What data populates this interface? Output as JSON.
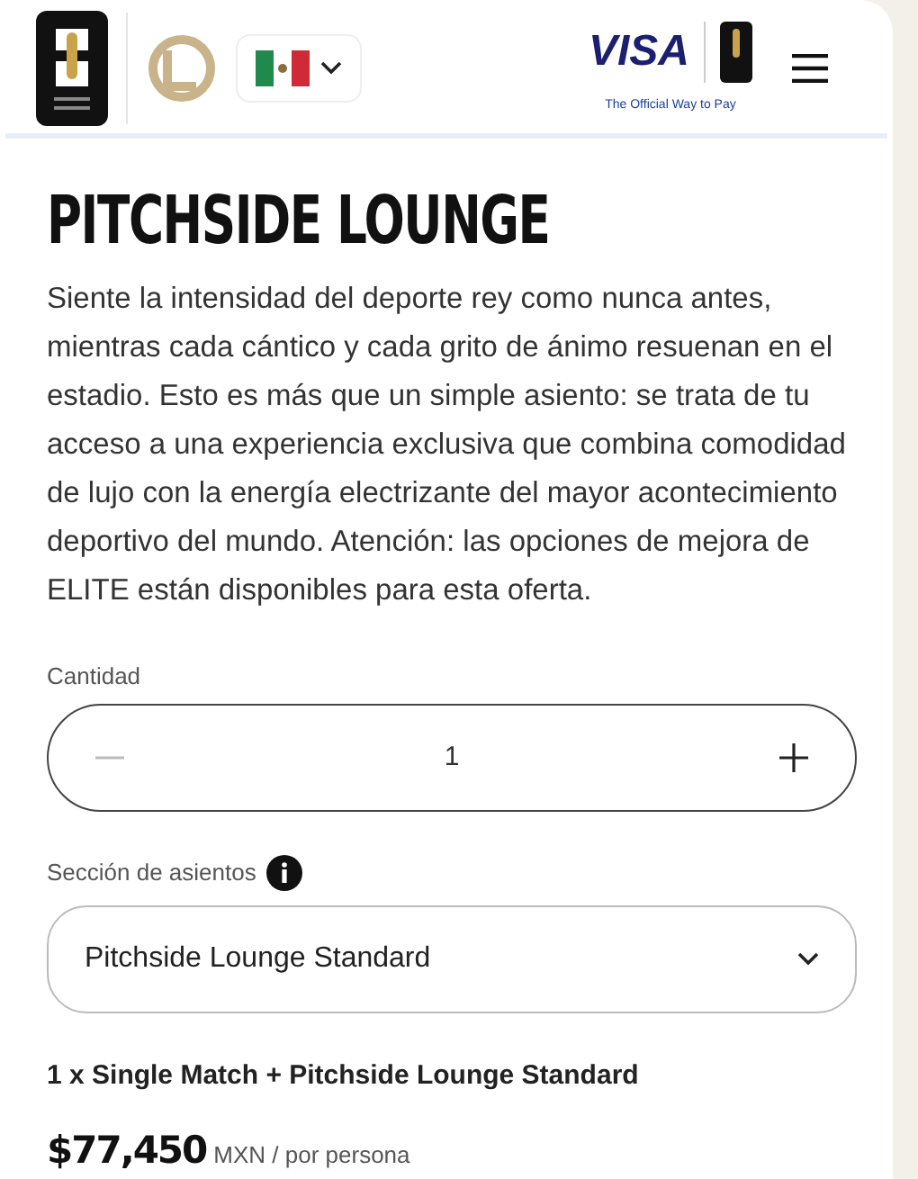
{
  "header": {
    "sponsor": {
      "name": "VISA",
      "tagline": "The Official Way to Pay"
    }
  },
  "product": {
    "title": "PITCHSIDE LOUNGE",
    "description": "Siente la intensidad del deporte rey como nunca antes, mientras cada cántico y cada grito de ánimo resuenan en el estadio. Esto es más que un simple asiento: se trata de tu acceso a una experiencia exclusiva que combina comodidad de lujo con la energía electrizante del mayor acontecimiento deportivo del mundo. Atención: las opciones de mejora de ELITE están disponibles para esta oferta."
  },
  "quantity": {
    "label": "Cantidad",
    "value": "1",
    "decrement_disabled": true
  },
  "seating": {
    "label": "Sección de asientos",
    "value": "Pitchside Lounge Standard"
  },
  "summary": {
    "line": "1 x Single Match + Pitchside Lounge Standard",
    "price": "$77,450",
    "price_unit": "MXN / por persona"
  }
}
